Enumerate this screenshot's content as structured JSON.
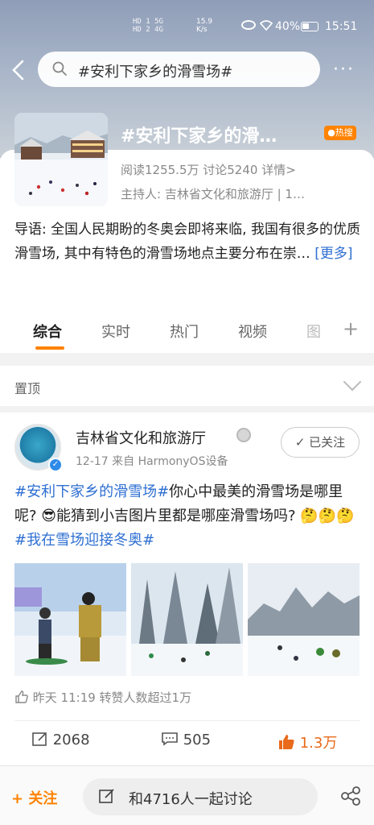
{
  "status_bar": {
    "signal_text": "HD 1 5G\nHD 2 4G",
    "net_speed": "15.9\nK/s",
    "battery": "40%",
    "time": "15:51"
  },
  "nav": {
    "search_text": "#安利下家乡的滑雪场#",
    "more_label": "···"
  },
  "topic": {
    "title": "#安利下家乡的滑…",
    "hot_badge": "热搜",
    "stats": "阅读1255.5万  讨论5240  详情>",
    "host": "主持人: 吉林省文化和旅游厅 | 1…",
    "intro": "导语: 全国人民期盼的冬奥会即将来临, 我国有很多的优质滑雪场, 其中有特色的滑雪场地点主要分布在崇…",
    "intro_more": "[更多]"
  },
  "tabs": [
    {
      "label": "综合"
    },
    {
      "label": "实时"
    },
    {
      "label": "热门"
    },
    {
      "label": "视频"
    },
    {
      "label": "图"
    }
  ],
  "pinned": {
    "label": "置顶"
  },
  "post": {
    "author": "吉林省文化和旅游厅",
    "meta": "12-17  来自 HarmonyOS设备",
    "follow_label": "已关注",
    "tag1": "#安利下家乡的滑雪场#",
    "text1": "你心中最美的滑雪场是哪里呢? 😎能猜到小吉图片里都是哪座滑雪场吗? 🤔🤔🤔",
    "tag2": "#我在雪场迎接冬奥#",
    "likers": "昨天 11:19 转赞人数超过1万",
    "repost_count": "2068",
    "comment_count": "505",
    "like_count": "1.3万"
  },
  "bottom": {
    "follow_label": "+ 关注",
    "discuss_label": "和4716人一起讨论"
  },
  "colors": {
    "accent": "#ff8200",
    "link": "#2e6fd2",
    "liked": "#e86a1a"
  }
}
